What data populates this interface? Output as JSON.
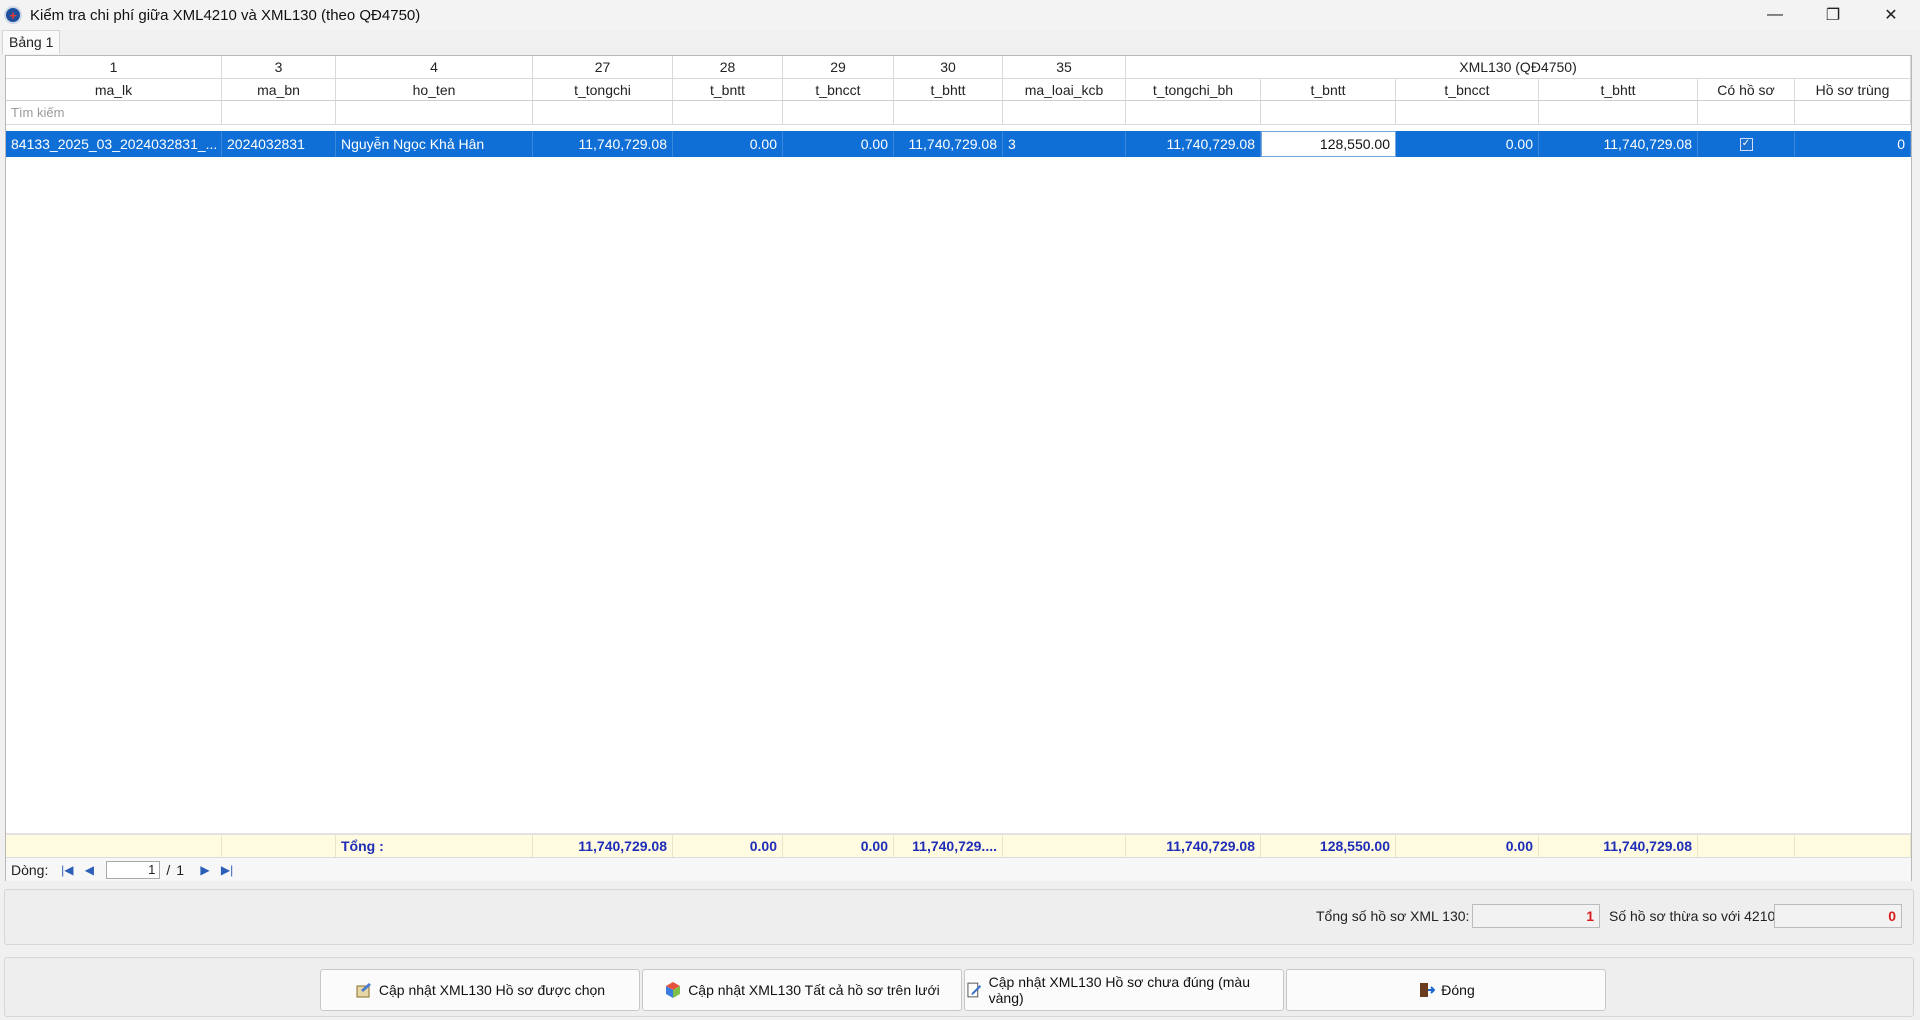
{
  "window": {
    "title": "Kiểm tra chi phí giữa XML4210 và XML130 (theo QĐ4750)",
    "app_icon": "red-cross-icon",
    "controls": {
      "minimize": "—",
      "restore": "❐",
      "close": "✕"
    }
  },
  "tabs": [
    {
      "label": "Bảng 1"
    }
  ],
  "grid": {
    "group_headers": {
      "c1": "1",
      "c3": "3",
      "c4": "4",
      "c27": "27",
      "c28": "28",
      "c29": "29",
      "c30": "30",
      "c35": "35",
      "xml130": "XML130 (QĐ4750)"
    },
    "columns": [
      "ma_lk",
      "ma_bn",
      "ho_ten",
      "t_tongchi",
      "t_bntt",
      "t_bncct",
      "t_bhtt",
      "ma_loai_kcb",
      "t_tongchi_bh",
      "t_bntt",
      "t_bncct",
      "t_bhtt",
      "Có hồ sơ",
      "Hồ sơ trùng"
    ],
    "filter_placeholder": "Tìm kiếm",
    "rows": [
      {
        "ma_lk": "84133_2025_03_2024032831_...",
        "ma_bn": "2024032831",
        "ho_ten": "Nguyễn Ngọc Khả Hân",
        "t_tongchi": "11,740,729.08",
        "t_bntt": "0.00",
        "t_bncct": "0.00",
        "t_bhtt": "11,740,729.08",
        "ma_loai_kcb": "3",
        "xml130_t_tongchi_bh": "11,740,729.08",
        "xml130_t_bntt": "128,550.00",
        "xml130_t_bncct": "0.00",
        "xml130_t_bhtt": "11,740,729.08",
        "co_ho_so": true,
        "ho_so_trung": "0"
      }
    ],
    "footer": {
      "label": "Tổng :",
      "t_tongchi": "11,740,729.08",
      "t_bntt": "0.00",
      "t_bncct": "0.00",
      "t_bhtt": "11,740,729....",
      "xml130_t_tongchi_bh": "11,740,729.08",
      "xml130_t_bntt": "128,550.00",
      "xml130_t_bncct": "0.00",
      "xml130_t_bhtt": "11,740,729.08"
    },
    "navigator": {
      "label": "Dòng:",
      "current_page": "1",
      "separator": "/",
      "total_pages": "1"
    }
  },
  "summary": {
    "total_label": "Tổng số hồ sơ XML 130:",
    "total_value": "1",
    "excess_label": "Số hồ sơ thừa so với 4210:",
    "excess_value": "0"
  },
  "buttons": {
    "update_selected": "Cập nhật XML130 Hồ sơ được chọn",
    "update_all": "Cập nhật XML130 Tất cả hồ sơ trên lưới",
    "update_incorrect": "Cập nhật XML130 Hồ sơ chưa đúng (màu vàng)",
    "close": "Đóng"
  },
  "colors": {
    "selection": "#0f6fd6",
    "footer_bg": "#fffbe0",
    "footer_text": "#1e2db8",
    "alert_text": "#d81b1b"
  }
}
